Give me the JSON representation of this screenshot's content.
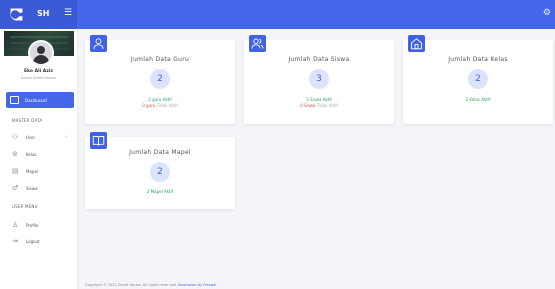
{
  "header": {
    "brand": "SH",
    "menu_icon": "hamburger-icon",
    "settings_icon": "gear-icon",
    "accent": "#4466e8"
  },
  "sidebar": {
    "user_name": "Eko Ali Aziz",
    "user_role": "Admin Smart House",
    "dashboard_label": "Dashboard",
    "section_master": "MASTER DATA",
    "section_user_menu": "USER MENU",
    "master_items": [
      {
        "label": "User",
        "icon": "users-icon"
      },
      {
        "label": "Kelas",
        "icon": "class-icon"
      },
      {
        "label": "Mapel",
        "icon": "book-icon"
      },
      {
        "label": "Siswa",
        "icon": "student-icon"
      }
    ],
    "user_items": [
      {
        "label": "Profile",
        "icon": "profile-icon"
      },
      {
        "label": "Logout",
        "icon": "logout-icon"
      }
    ]
  },
  "cards": [
    {
      "title": "Jumlah Data Guru",
      "count": "2",
      "active": "2 guru Aktif",
      "inactive_num": "0 guru",
      "inactive_text": "Tidak Aktif",
      "icon": "user-icon"
    },
    {
      "title": "Jumlah Data Siswa",
      "count": "3",
      "active": "3 Siswa Aktif",
      "inactive_num": "0 Siswa",
      "inactive_text": "Tidak Aktif",
      "icon": "users-icon"
    },
    {
      "title": "Jumlah Data Kelas",
      "count": "2",
      "active": "2 Kelas Aktif",
      "icon": "home-icon"
    },
    {
      "title": "Jumlah Data Mapel",
      "count": "2",
      "active": "2 Mapel Aktif",
      "icon": "book-icon"
    }
  ],
  "footer": {
    "text": "Copyright © 2022 Smart House. All rights reser ved.",
    "link": "Illustration by Freepik"
  }
}
